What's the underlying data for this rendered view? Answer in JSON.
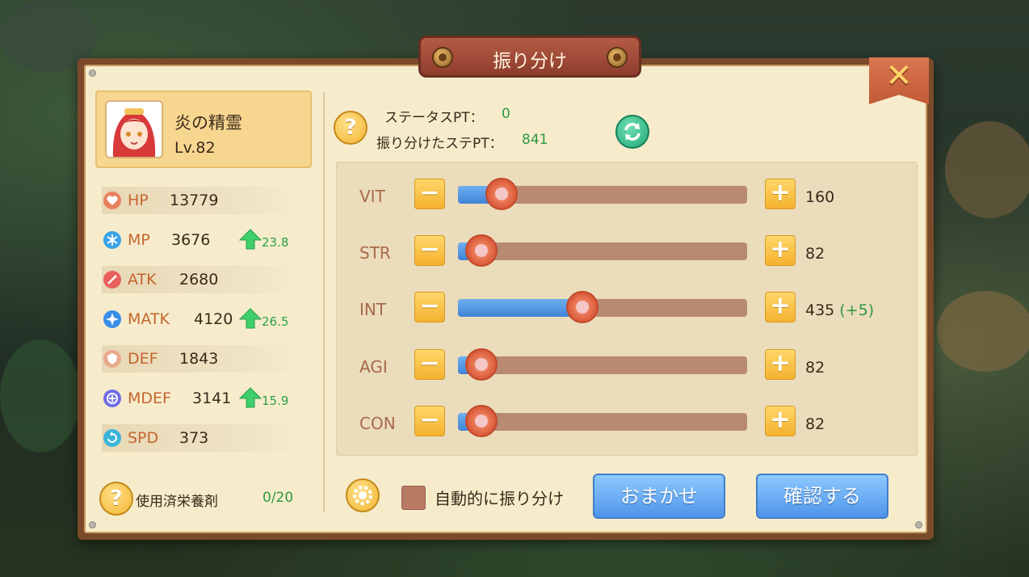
{
  "window": {
    "title": "振り分け",
    "close_icon": "close-x-icon"
  },
  "character": {
    "name": "炎の精霊",
    "level": "Lv.82"
  },
  "stats": [
    {
      "key": "hp",
      "label": "HP",
      "value": "13779",
      "icon": "heart-icon",
      "color": "#e9815d",
      "bonus": null
    },
    {
      "key": "mp",
      "label": "MP",
      "value": "3676",
      "icon": "snowflake-icon",
      "color": "#3aa3e8",
      "bonus": "23.8"
    },
    {
      "key": "atk",
      "label": "ATK",
      "value": "2680",
      "icon": "sword-icon",
      "color": "#e9615d",
      "bonus": null
    },
    {
      "key": "matk",
      "label": "MATK",
      "value": "4120",
      "icon": "star-icon",
      "color": "#3a8ee8",
      "bonus": "26.5"
    },
    {
      "key": "def",
      "label": "DEF",
      "value": "1843",
      "icon": "shield-icon",
      "color": "#e9a98d",
      "bonus": null
    },
    {
      "key": "mdef",
      "label": "MDEF",
      "value": "3141",
      "icon": "magic-shield-icon",
      "color": "#6f6be8",
      "bonus": "15.9"
    },
    {
      "key": "spd",
      "label": "SPD",
      "value": "373",
      "icon": "speed-icon",
      "color": "#3ab5d8",
      "bonus": null
    }
  ],
  "points": {
    "status_pt_label": "ステータスPT：",
    "status_pt_value": "0",
    "allocated_pt_label": "振り分けたステPT：",
    "allocated_pt_value": "841"
  },
  "attributes": [
    {
      "name": "VIT",
      "value": "160",
      "bonus": "",
      "fill_pct": 15
    },
    {
      "name": "STR",
      "value": "82",
      "bonus": "",
      "fill_pct": 8
    },
    {
      "name": "INT",
      "value": "435",
      "bonus": " (+5)",
      "fill_pct": 43
    },
    {
      "name": "AGI",
      "value": "82",
      "bonus": "",
      "fill_pct": 8
    },
    {
      "name": "CON",
      "value": "82",
      "bonus": "",
      "fill_pct": 8
    }
  ],
  "buttons": {
    "minus": "−",
    "plus": "+",
    "help": "?",
    "auto_label": "自動的に振り分け",
    "omakase": "おまかせ",
    "confirm": "確認する"
  },
  "potion": {
    "label": "使用済栄養剤",
    "value": "0/20"
  }
}
